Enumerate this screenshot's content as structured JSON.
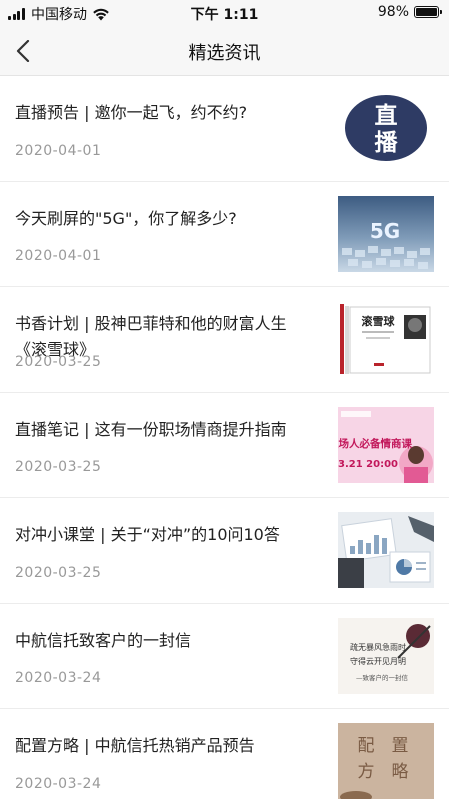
{
  "status_bar": {
    "carrier": "中国移动",
    "time": "下午 1:11",
    "battery": "98%",
    "battery_level": 0.98
  },
  "nav": {
    "back_icon": "chevron-left-icon",
    "title": "精选资讯"
  },
  "news": [
    {
      "title": "直播预告 | 邀你一起飞，约不约?",
      "date": "2020-04-01",
      "thumb_text": "直播"
    },
    {
      "title": "今天刷屏的\"5G\"，你了解多少?",
      "date": "2020-04-01",
      "thumb_text": "5G"
    },
    {
      "title": "书香计划 | 股神巴菲特和他的财富人生《滚雪球》",
      "date": "2020-03-25",
      "thumb_text": "滚雪球"
    },
    {
      "title": "直播笔记 | 这有一份职场情商提升指南",
      "date": "2020-03-25",
      "thumb_text": "职场人必备情商课",
      "thumb_sub": "3.21 20:00"
    },
    {
      "title": "对冲小课堂 | 关于“对冲”的10问10答",
      "date": "2020-03-25"
    },
    {
      "title": "中航信托致客户的一封信",
      "date": "2020-03-24",
      "thumb_text": "疏无暴风急雨时 守得云开见月明",
      "thumb_sub": "—致客户的一封信"
    },
    {
      "title": "配置方略 | 中航信托热销产品预告",
      "date": "2020-03-24",
      "thumb_text": "配置方略"
    }
  ]
}
